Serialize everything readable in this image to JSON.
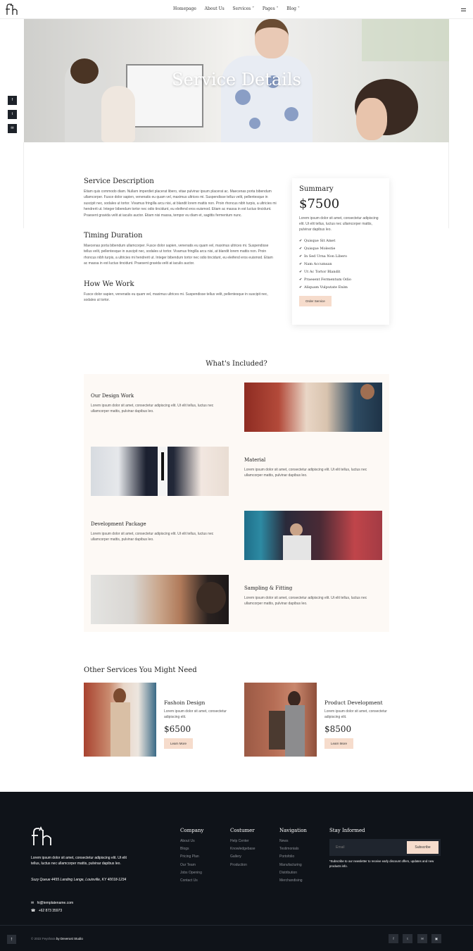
{
  "header": {
    "nav": [
      "Homepage",
      "About Us",
      "Services ˅",
      "Pages ˅",
      "Blog ˅"
    ]
  },
  "side_social": [
    "f",
    "t",
    "✉"
  ],
  "hero": {
    "title": "Service Details"
  },
  "service": {
    "description_title": "Service Description",
    "description_text": "Etiam quis commodo diam. Nullam imperdiet placerat libero, vitae pulvinar ipsum placerat ac. Maecenas porta bibendum ullamcorper. Fusce dolor sapien, venenatis eu quam vel, maximus ultrices mi. Suspendisse tellus velit, pellentesque in suscipit nec, sodales ut tortor. Vivamus fringilla arcu nisi, at blandit lorem mattis non. Proin rhoncus nibh turpis, a ultricies mi hendrerit ut. Integer bibendum tortor nec odio tincidunt, eu eleifend eros euismod. Etiam ac massa in est luctus tincidunt. Praesent gravida velit at iaculis auctor. Etiam nisi massa, tempor eu diam et, sagittis fermentum nunc.",
    "timing_title": "Timing Duration",
    "timing_text": "Maecenas porta bibendum ullamcorper. Fusce dolor sapien, venenatis eu quam vel, maximus ultrices mi. Suspendisse tellus velit, pellentesque in suscipit nec, sodales ut tortor. Vivamus fringilla arcu nisi, at blandit lorem mattis non. Proin rhoncus nibh turpis, a ultricies mi hendrerit ut. Integer bibendum tortor nec odio tincidunt, eu eleifend eros euismod. Etiam ac massa in est luctus tincidunt. Praesent gravida velit at iaculis auctor.",
    "how_title": "How We Work",
    "how_text": "Fusce dolor sapien, venenatis eu quam vel, maximus ultrices mi. Suspendisse tellus velit, pellentesque in suscipit nec, sodales ut tortor."
  },
  "summary": {
    "title": "Summary",
    "price": "$7500",
    "text": "Lorem ipsum dolor sit amet, consectetur adipiscing elit. Ut elit tellus, luctus nec ullamcorper mattis, pulvinar dapibus leo.",
    "items": [
      "Quisque Sit Amet",
      "Quisque Molestie",
      "In Sed Urna Non Libero",
      "Nam Accumsan",
      "Ut Ac Tortor Blandit",
      "Praesent Fermentum Odio",
      "Aliquam Vulputate Enim"
    ],
    "button": "Order Service"
  },
  "included": {
    "title": "What's Included?",
    "items": [
      {
        "title": "Our Design Work",
        "text": "Lorem ipsum dolor sit amet, consectetur adipiscing elit. Ut elit tellus, luctus nec ullamcorper mattis, pulvinar dapibus leo."
      },
      {
        "title": "Material",
        "text": "Lorem ipsum dolor sit amet, consectetur adipiscing elit. Ut elit tellus, luctus nec ullamcorper mattis, pulvinar dapibus leo."
      },
      {
        "title": "Development Package",
        "text": "Lorem ipsum dolor sit amet, consectetur adipiscing elit. Ut elit tellus, luctus nec ullamcorper mattis, pulvinar dapibus leo."
      },
      {
        "title": "Sampling & Fitting",
        "text": "Lorem ipsum dolor sit amet, consectetur adipiscing elit. Ut elit tellus, luctus nec ullamcorper mattis, pulvinar dapibus leo."
      }
    ]
  },
  "other": {
    "title": "Other Services You Might Need",
    "services": [
      {
        "name": "Fashoin Design",
        "text": "Lorem ipsum dolor sit amet, consectetur adipiscing elit.",
        "price": "$6500",
        "button": "Learn More"
      },
      {
        "name": "Product Development",
        "text": "Lorem ipsum dolor sit amet, consectetur adipiscing elit.",
        "price": "$8500",
        "button": "Learn More"
      }
    ]
  },
  "footer": {
    "about": "Lorem ipsum dolor sit amet, consectetur adipiscing elit. Ut elit tellus, luctus nec ullamcorper mattis, pulvinar dapibus leo.",
    "address": "Suzy Queue 4455 Landing Lange, Louisville, KY 40018-1234",
    "email": "hi@templatename.com",
    "phone": "+62 873 35973",
    "columns": [
      {
        "title": "Company",
        "links": [
          "About Us",
          "Blogs",
          "Pricing Plan",
          "Our Team",
          "Jobs Opening",
          "Contact Us"
        ]
      },
      {
        "title": "Costumer",
        "links": [
          "Help Center",
          "Knowledgebase",
          "Gallery",
          "Production"
        ]
      },
      {
        "title": "Navigation",
        "links": [
          "News",
          "Testimonials",
          "Portofolio",
          "Manufacturing",
          "Distribution",
          "Merchandising"
        ]
      }
    ],
    "newsletter": {
      "title": "Stay Informed",
      "placeholder": "Email",
      "button": "Subscribe",
      "note": "*Subscribe to our newsletter to receive early discount offers, updates and new products info."
    },
    "copyright": "© 2022 Feyshara",
    "studio": "by Deverust Studio",
    "socials": [
      "f",
      "t",
      "✉",
      "▣"
    ]
  },
  "colors": {
    "accent": "#f6dccc",
    "footer_bg": "#0f1319",
    "included_bg": "#fdf9f5"
  }
}
